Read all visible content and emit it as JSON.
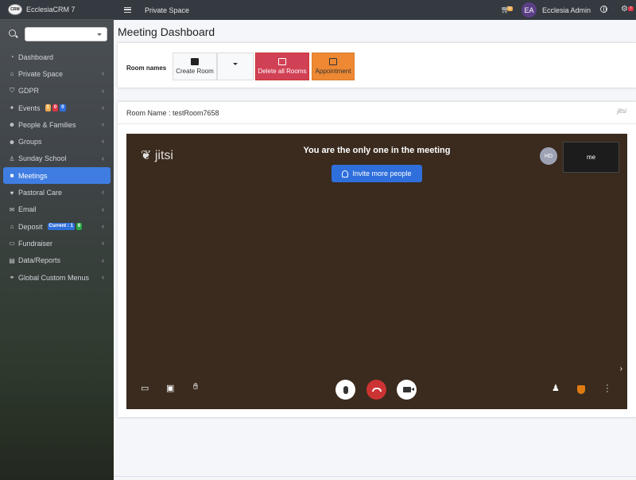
{
  "app": {
    "brand": "EcclesiaCRM 7",
    "logo_text": "CRM"
  },
  "topbar": {
    "title": "Private Space",
    "cart_count": "0",
    "avatar_initials": "EA",
    "user_name": "Ecclesia Admin",
    "settings_count": "7"
  },
  "sidebar": {
    "items": [
      {
        "label": "Dashboard",
        "icon": "dashboard-icon",
        "glyph": "◔",
        "has_chevron": false
      },
      {
        "label": "Private Space",
        "icon": "home-icon",
        "glyph": "⌂",
        "has_chevron": true
      },
      {
        "label": "GDPR",
        "icon": "shield-icon",
        "glyph": "⛉",
        "has_chevron": true
      },
      {
        "label": "Events",
        "icon": "ticket-icon",
        "glyph": "✦",
        "has_chevron": true,
        "badges": [
          {
            "text": "1",
            "color": "#f0ad4e"
          },
          {
            "text": "0",
            "color": "#dc3545"
          },
          {
            "text": "0",
            "color": "#2f6fdc"
          }
        ]
      },
      {
        "label": "People & Families",
        "icon": "people-icon",
        "glyph": "☻",
        "has_chevron": true
      },
      {
        "label": "Groups",
        "icon": "users-icon",
        "glyph": "☻",
        "has_chevron": true
      },
      {
        "label": "Sunday School",
        "icon": "child-icon",
        "glyph": "♙",
        "has_chevron": true
      },
      {
        "label": "Meetings",
        "icon": "video-icon",
        "glyph": "■",
        "has_chevron": false,
        "active": true
      },
      {
        "label": "Pastoral Care",
        "icon": "heart-icon",
        "glyph": "♥",
        "has_chevron": true
      },
      {
        "label": "Email",
        "icon": "envelope-icon",
        "glyph": "✉",
        "has_chevron": true
      },
      {
        "label": "Deposit",
        "icon": "bank-icon",
        "glyph": "⌂",
        "has_chevron": true,
        "badges": [
          {
            "text": "Current : 1",
            "color": "#2f6fdc"
          },
          {
            "text": "6",
            "color": "#28a745"
          }
        ]
      },
      {
        "label": "Fundraiser",
        "icon": "money-icon",
        "glyph": "▭",
        "has_chevron": true
      },
      {
        "label": "Data/Reports",
        "icon": "file-icon",
        "glyph": "▤",
        "has_chevron": true
      },
      {
        "label": "Global Custom Menus",
        "icon": "link-icon",
        "glyph": "⚭",
        "has_chevron": true
      }
    ]
  },
  "page": {
    "title": "Meeting Dashboard"
  },
  "toolbar": {
    "room_names_label": "Room names",
    "create_label": "Create Room",
    "delete_label": "Delete all Rooms",
    "appointment_label": "Appointment"
  },
  "room": {
    "name_label": "Room Name : testRoom7658",
    "small_logo": "jitsi"
  },
  "video": {
    "logo": "jitsi",
    "message": "You are the only one in the meeting",
    "invite_label": "Invite more people",
    "participant_initials": "HD",
    "self_label": "me"
  },
  "colors": {
    "accent": "#3f7de2",
    "danger": "#d14155",
    "warning": "#ee8833",
    "topbar": "#343a40"
  }
}
